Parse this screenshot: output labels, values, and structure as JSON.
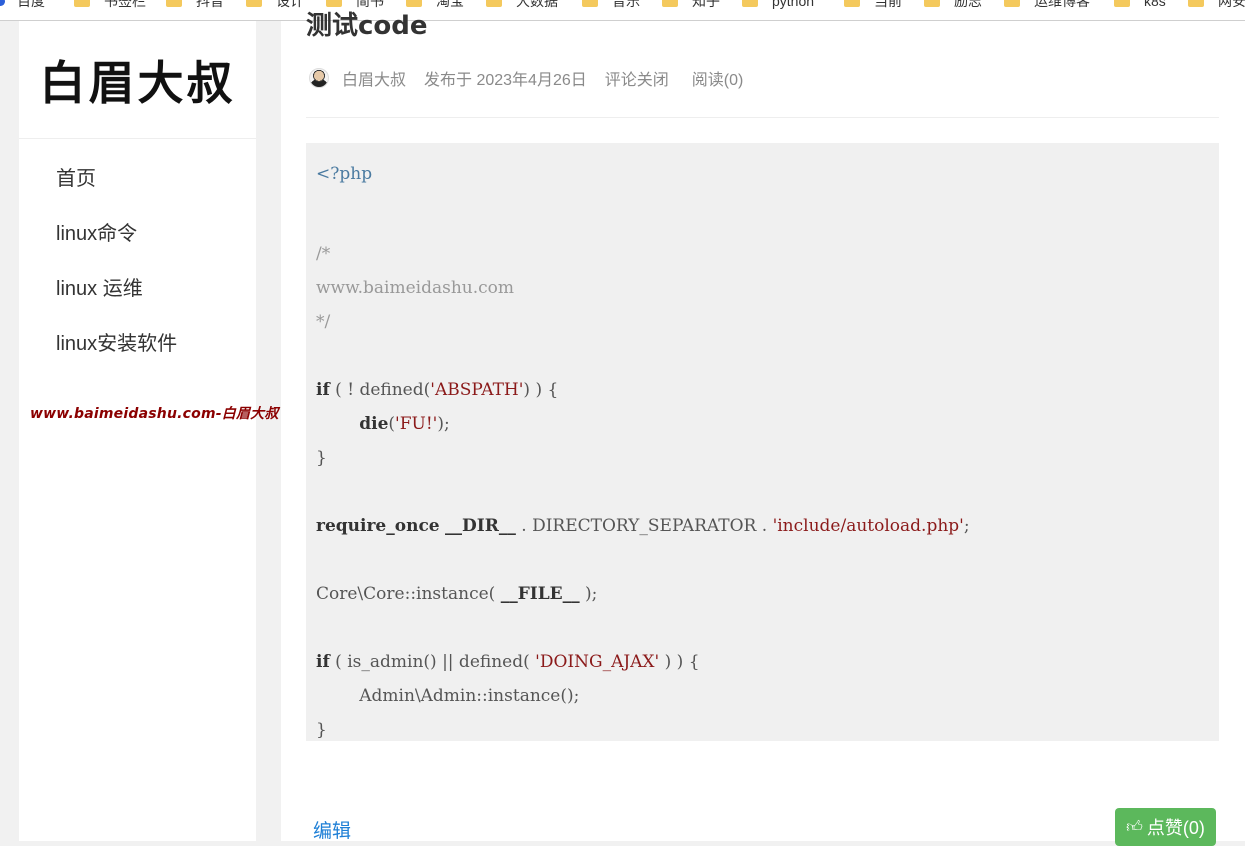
{
  "bookmarks": [
    {
      "label": "百度",
      "icon": "baidu-icon"
    },
    {
      "label": "书签栏",
      "icon": "folder-icon"
    },
    {
      "label": "抖音",
      "icon": "folder-icon"
    },
    {
      "label": "设计",
      "icon": "folder-icon"
    },
    {
      "label": "简书",
      "icon": "folder-icon"
    },
    {
      "label": "淘宝",
      "icon": "folder-icon"
    },
    {
      "label": "大数据",
      "icon": "folder-icon"
    },
    {
      "label": "音乐",
      "icon": "folder-icon"
    },
    {
      "label": "知乎",
      "icon": "folder-icon"
    },
    {
      "label": "python",
      "icon": "folder-icon"
    },
    {
      "label": "当前",
      "icon": "folder-icon"
    },
    {
      "label": "励志",
      "icon": "folder-icon"
    },
    {
      "label": "运维博客",
      "icon": "folder-icon"
    },
    {
      "label": "k8s",
      "icon": "folder-icon"
    },
    {
      "label": "网安",
      "icon": "folder-icon"
    }
  ],
  "site": {
    "logo_text": "白眉大叔",
    "watermark": "www.baimeidashu.com-白眉大叔"
  },
  "nav": {
    "items": [
      {
        "label": "首页"
      },
      {
        "label": "linux命令"
      },
      {
        "label": "linux 运维"
      },
      {
        "label": "linux安装软件"
      }
    ]
  },
  "post": {
    "title": "测试code",
    "author": "白眉大叔",
    "published": "发布于 2023年4月26日",
    "comments": "评论关闭",
    "reads": "阅读(0)"
  },
  "code": {
    "l1": "<?php",
    "l2": "/*",
    "l3": "www.baimeidashu.com",
    "l4": "*/",
    "l5_kw": "if",
    "l5_a": " ( ! defined(",
    "l5_s": "'ABSPATH'",
    "l5_b": ") ) {",
    "l6_kw": "die",
    "l6_a": "(",
    "l6_s": "'FU!'",
    "l6_b": ");",
    "l7": "}",
    "l8_kw1": "require_once",
    "l8_kw2": "__DIR__",
    "l8_a": " . DIRECTORY_SEPARATOR . ",
    "l8_s": "'include/autoload.php'",
    "l8_b": ";",
    "l9_a": "Core\\Core::instance( ",
    "l9_kw": "__FILE__",
    "l9_b": " );",
    "l10_kw": "if",
    "l10_a": " ( is_admin() || defined( ",
    "l10_s": "'DOING_AJAX'",
    "l10_b": " ) ) {",
    "l11": "Admin\\Admin::instance();",
    "l12": "}"
  },
  "footer": {
    "edit_label": "编辑",
    "like_label": "点赞(0)"
  },
  "colors": {
    "like_button": "#5cb85c",
    "edit_link": "#1e7fd6",
    "watermark": "#8b0000"
  }
}
